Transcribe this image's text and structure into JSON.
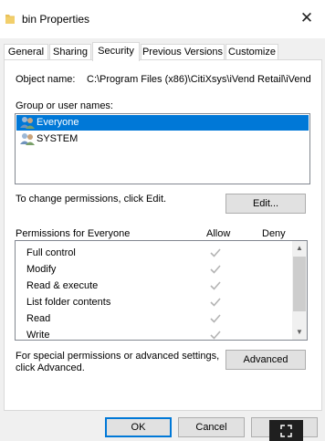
{
  "window": {
    "title": "bin Properties",
    "close_glyph": "✕"
  },
  "tabs": [
    {
      "label": "General"
    },
    {
      "label": "Sharing"
    },
    {
      "label": "Security"
    },
    {
      "label": "Previous Versions"
    },
    {
      "label": "Customize"
    }
  ],
  "security": {
    "object_name_label": "Object name:",
    "object_name_value": "C:\\Program Files (x86)\\CitiXsys\\iVend Retail\\iVend",
    "group_label": "Group or user names:",
    "groups": [
      {
        "name": "Everyone",
        "selected": true
      },
      {
        "name": "SYSTEM",
        "selected": false
      }
    ],
    "change_text": "To change permissions, click Edit.",
    "edit_button": "Edit...",
    "permissions_label": "Permissions for Everyone",
    "allow_header": "Allow",
    "deny_header": "Deny",
    "permissions": [
      {
        "name": "Full control",
        "allow": true,
        "deny": false
      },
      {
        "name": "Modify",
        "allow": true,
        "deny": false
      },
      {
        "name": "Read & execute",
        "allow": true,
        "deny": false
      },
      {
        "name": "List folder contents",
        "allow": true,
        "deny": false
      },
      {
        "name": "Read",
        "allow": true,
        "deny": false
      },
      {
        "name": "Write",
        "allow": true,
        "deny": false
      }
    ],
    "special_text_line1": "For special permissions or advanced settings,",
    "special_text_line2": "click Advanced.",
    "advanced_button": "Advanced"
  },
  "footer": {
    "ok_button": "OK",
    "cancel_button": "Cancel"
  },
  "colors": {
    "selection": "#0078d7",
    "check_gray": "#b4b4b4",
    "folder_yellow": "#e8c15a"
  }
}
